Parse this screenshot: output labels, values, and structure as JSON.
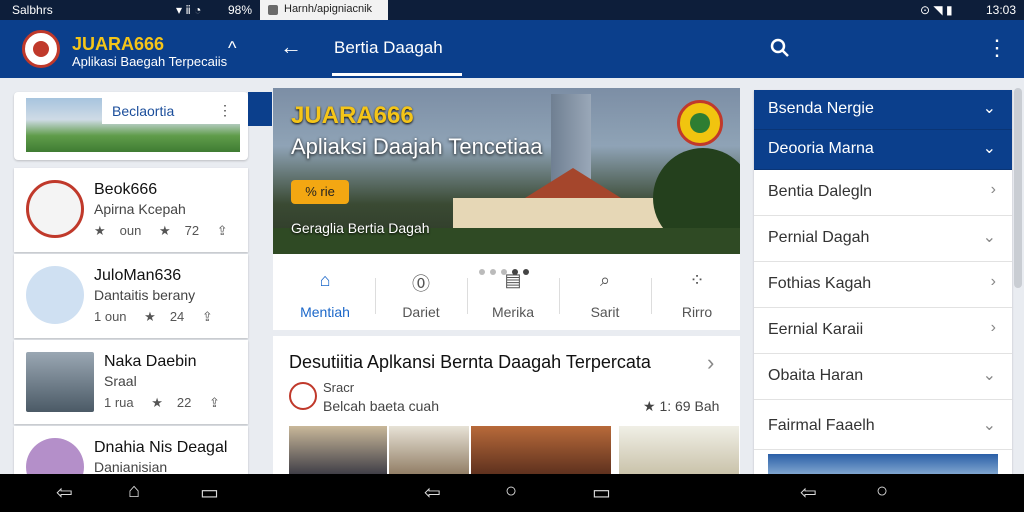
{
  "status_bar": {
    "left_text": "Salbhrs",
    "tab_text": "Harnh/apigniacnik",
    "battery": "98%",
    "time": "13:03"
  },
  "app_bar": {
    "brand_title": "JUARA666",
    "brand_subtitle": "Aplikasi Baegah Terpecaiis",
    "page_title": "Bertia Daagah"
  },
  "left": {
    "banner_chip": "Beclaortia",
    "cards": [
      {
        "title": "Beok666",
        "subtitle": "Apirna Kcepah",
        "stat1": "oun",
        "stat2": "72"
      },
      {
        "title": "JuloMan636",
        "subtitle": "Dantaitis berany",
        "stat1": "1 oun",
        "stat2": "24"
      },
      {
        "title": "Naka Daebin",
        "subtitle": "Sraal",
        "stat1": "1 rua",
        "stat2": "22"
      },
      {
        "title": "Dnahia Nis Deagal",
        "subtitle": "Danianisian",
        "stat1": "",
        "stat2": ""
      }
    ]
  },
  "hero": {
    "title": "JUARA666",
    "subtitle": "Apliaksi Daajah Tencetiaa",
    "badge": "% rie",
    "caption": "Geraglia Bertia Dagah"
  },
  "tabs": [
    {
      "label": "Mentiah",
      "icon": "home-icon"
    },
    {
      "label": "Dariet",
      "icon": "info-icon"
    },
    {
      "label": "Merika",
      "icon": "news-icon"
    },
    {
      "label": "Sarit",
      "icon": "search-icon"
    },
    {
      "label": "Rirro",
      "icon": "grid-icon"
    }
  ],
  "article": {
    "title": "Desutiitia  Aplkansi Bernta Daagah Terpercata",
    "author": "Sracr",
    "source": "Belcah baeta cuah",
    "meta": "1: 69 Bah"
  },
  "right_menu": [
    {
      "label": "Bsenda Nergie",
      "highlight": true
    },
    {
      "label": "Deooria Marna",
      "highlight": true
    },
    {
      "label": "Bentia Dalegln",
      "highlight": false
    },
    {
      "label": "Pernial Dagah",
      "highlight": false
    },
    {
      "label": "Fothias Kagah",
      "highlight": false
    },
    {
      "label": "Eernial Karaii",
      "highlight": false
    },
    {
      "label": "Obaita Haran",
      "highlight": false
    },
    {
      "label": "Fairmal Faaelh",
      "highlight": false
    }
  ],
  "colors": {
    "primary": "#0b3f8c",
    "accent": "#f5c518",
    "active_tab": "#1b67c9"
  }
}
